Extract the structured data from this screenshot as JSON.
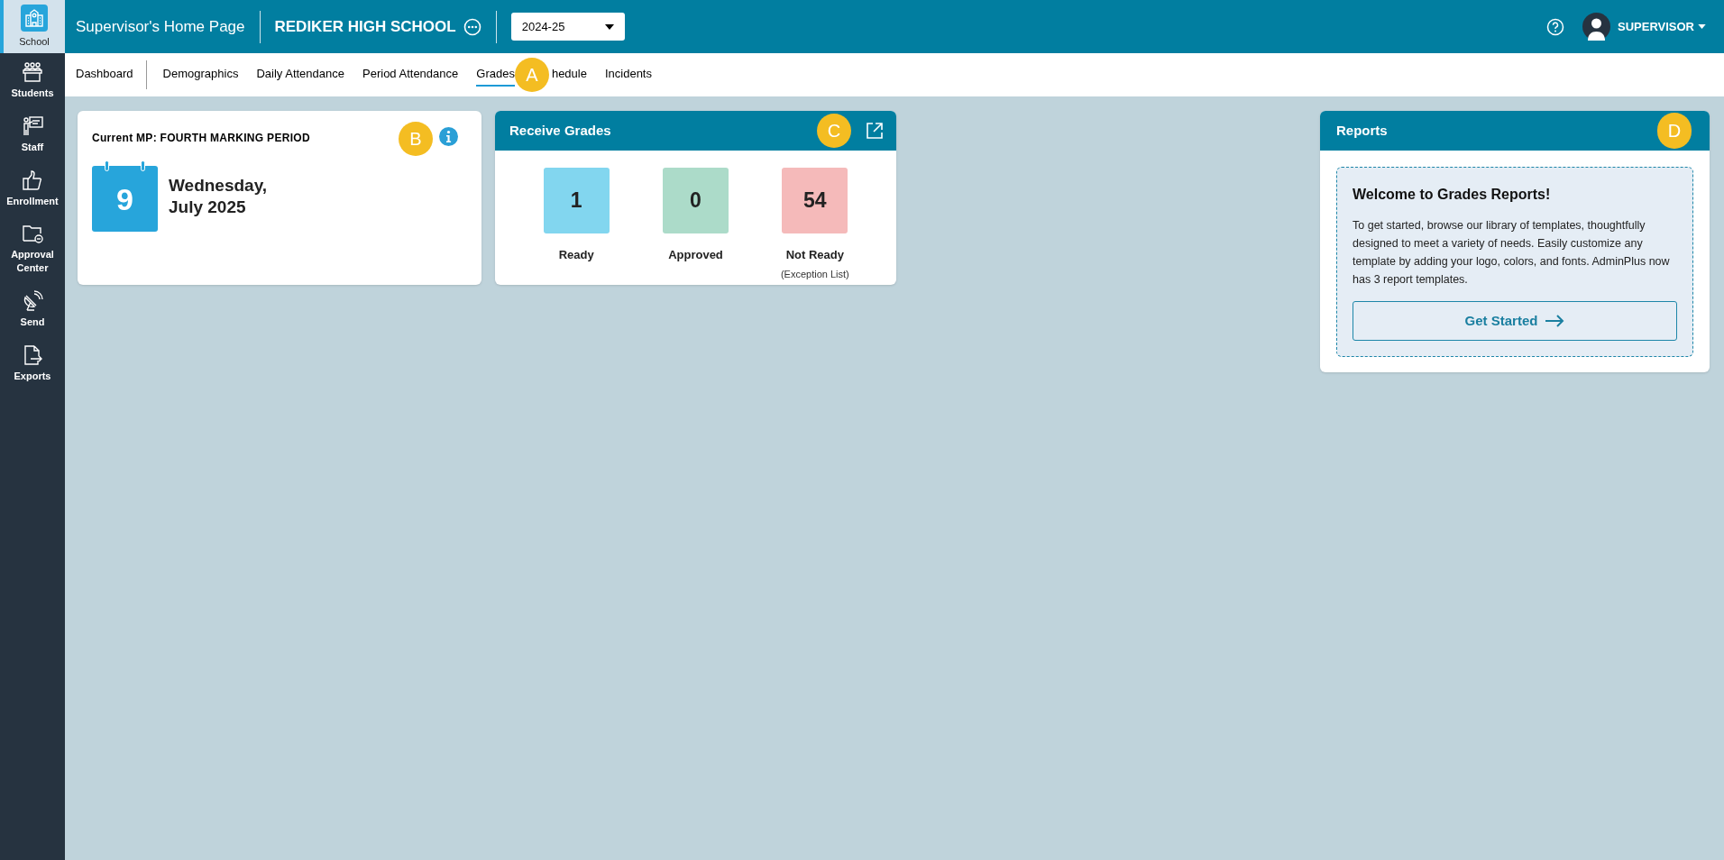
{
  "sidebar": {
    "items": [
      {
        "label": "School",
        "selected": true
      },
      {
        "label": "Students",
        "selected": false
      },
      {
        "label": "Staff",
        "selected": false
      },
      {
        "label": "Enrollment",
        "selected": false
      },
      {
        "label": "Approval Center",
        "selected": false
      },
      {
        "label": "Send",
        "selected": false
      },
      {
        "label": "Exports",
        "selected": false
      }
    ]
  },
  "header": {
    "title": "Supervisor's Home Page",
    "school": "REDIKER HIGH SCHOOL",
    "year": "2024-25",
    "user": "SUPERVISOR"
  },
  "nav": {
    "tabs": [
      {
        "label": "Dashboard",
        "selected": false
      },
      {
        "label": "Demographics",
        "selected": false
      },
      {
        "label": "Daily Attendance",
        "selected": false
      },
      {
        "label": "Period Attendance",
        "selected": false
      },
      {
        "label": "Grades",
        "selected": true
      },
      {
        "label": "hedule",
        "selected": false
      },
      {
        "label": "Incidents",
        "selected": false
      }
    ],
    "callout": "A"
  },
  "marking_period": {
    "title": "Current MP: FOURTH MARKING PERIOD",
    "day": "9",
    "weekday": "Wednesday,",
    "month_year": "July 2025",
    "callout": "B"
  },
  "receive_grades": {
    "title": "Receive Grades",
    "callout": "C",
    "tiles": [
      {
        "count": "1",
        "label": "Ready",
        "color": "#82d6ef"
      },
      {
        "count": "0",
        "label": "Approved",
        "color": "#acdbc9"
      },
      {
        "count": "54",
        "label": "Not Ready",
        "note": "(Exception List)",
        "color": "#f5baba"
      }
    ]
  },
  "reports": {
    "title": "Reports",
    "callout": "D",
    "heading": "Welcome to Grades Reports!",
    "text": "To get started, browse our library of templates, thoughtfully designed to meet a variety of needs. Easily customize any template by adding your logo, colors, and fonts. AdminPlus now has 3 report templates.",
    "button": "Get Started"
  }
}
